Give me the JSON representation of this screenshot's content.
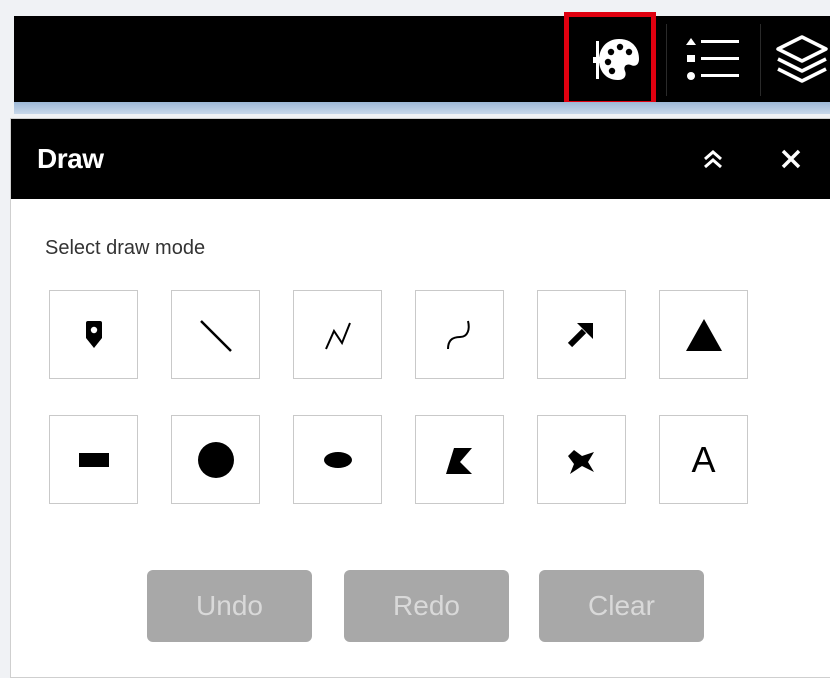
{
  "toolbar": {
    "icons": [
      "palette-icon",
      "legend-list-icon",
      "layers-icon"
    ],
    "highlight_color": "#e0000f"
  },
  "panel": {
    "title": "Draw",
    "prompt": "Select draw mode",
    "tools": [
      {
        "name": "point-icon"
      },
      {
        "name": "line-icon"
      },
      {
        "name": "polyline-icon"
      },
      {
        "name": "freehand-line-icon"
      },
      {
        "name": "arrow-icon"
      },
      {
        "name": "triangle-icon"
      },
      {
        "name": "rectangle-icon"
      },
      {
        "name": "circle-icon"
      },
      {
        "name": "ellipse-icon"
      },
      {
        "name": "polygon-icon"
      },
      {
        "name": "freehand-polygon-icon"
      },
      {
        "name": "text-icon",
        "label": "A"
      }
    ],
    "actions": {
      "undo": "Undo",
      "redo": "Redo",
      "clear": "Clear"
    }
  }
}
